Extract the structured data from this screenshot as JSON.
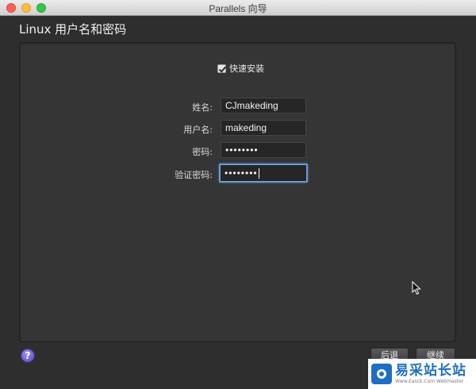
{
  "window": {
    "title": "Parallels 向导"
  },
  "page": {
    "title": "Linux 用户名和密码"
  },
  "quick_install": {
    "label": "快速安装",
    "checked": true
  },
  "form": {
    "fields": [
      {
        "label": "姓名:",
        "value": "CJmakeding"
      },
      {
        "label": "用户名:",
        "value": "makeding"
      },
      {
        "label": "密码:",
        "value": "••••••••"
      },
      {
        "label": "验证密码:",
        "value": "••••••••"
      }
    ]
  },
  "buttons": {
    "back": "后退",
    "continue": "继续",
    "help": "?"
  },
  "watermark": {
    "name": "易采站长站",
    "url": "Www.Easck.Com  Webmaster"
  }
}
